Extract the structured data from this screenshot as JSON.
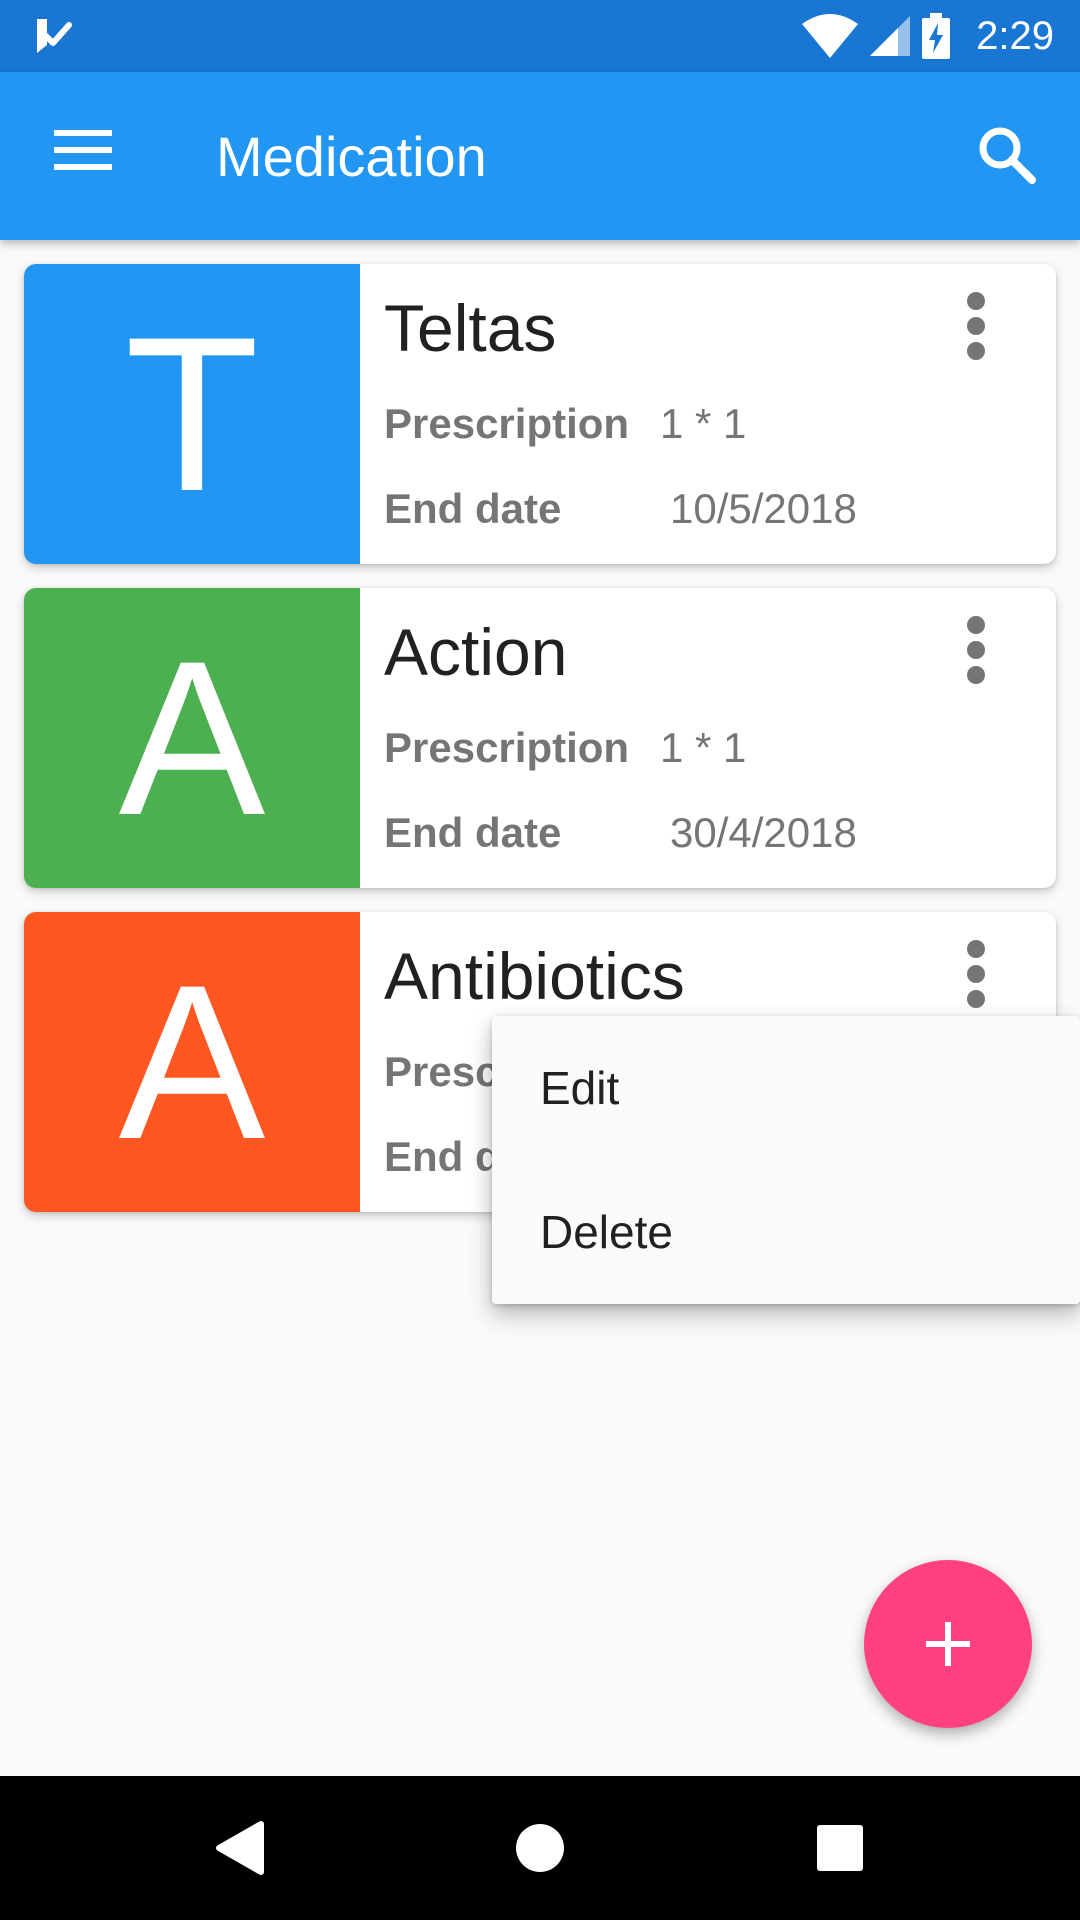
{
  "status_bar": {
    "time": "2:29",
    "icons": [
      "notification-check-icon",
      "wifi-icon",
      "cell-signal-icon",
      "battery-charging-icon"
    ]
  },
  "app_bar": {
    "title": "Medication",
    "icons": [
      "menu-icon",
      "search-icon"
    ]
  },
  "medications": [
    {
      "initial": "T",
      "name": "Teltas",
      "prescription_label": "Prescription",
      "prescription": "1 * 1",
      "end_date_label": "End date",
      "end_date": "10/5/2018",
      "color": "#2196f3"
    },
    {
      "initial": "A",
      "name": "Action",
      "prescription_label": "Prescription",
      "prescription": "1 * 1",
      "end_date_label": "End date",
      "end_date": "30/4/2018",
      "color": "#4caf50"
    },
    {
      "initial": "A",
      "name": "Antibiotics",
      "prescription_label": "Presc",
      "prescription": "",
      "end_date_label": "End d",
      "end_date": "",
      "color": "#ff5722"
    }
  ],
  "context_menu": {
    "items": [
      "Edit",
      "Delete"
    ]
  },
  "colors": {
    "status_bar": "#1976d2",
    "app_bar": "#2196f3",
    "fab": "#ff4081"
  },
  "fab": {
    "icon": "add-icon"
  },
  "nav_bar": {
    "icons": [
      "back-icon",
      "home-icon",
      "recents-icon"
    ]
  }
}
